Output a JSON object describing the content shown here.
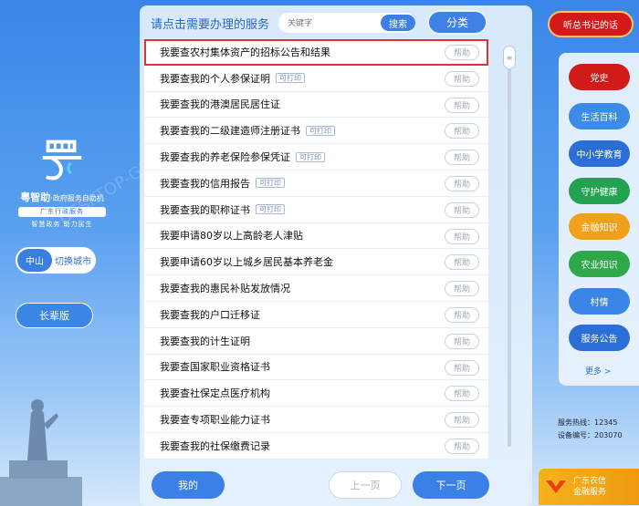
{
  "header": {
    "prompt": "请点击需要办理的服务",
    "search_placeholder": "关键字",
    "search_label": "搜索",
    "category_label": "分类"
  },
  "brand": {
    "title": "粤智助",
    "subtitle": "·政府服务自助机",
    "org": "广东行政服务",
    "slogan": "智慧政务  助力民生"
  },
  "city": {
    "current": "中山",
    "switch_label": "切换城市"
  },
  "elder_mode_label": "长辈版",
  "services": [
    {
      "label": "我要查农村集体资产的招标公告和结果",
      "printable": false,
      "selected": true
    },
    {
      "label": "我要查我的个人参保证明",
      "printable": true
    },
    {
      "label": "我要查我的港澳居民居住证",
      "printable": false
    },
    {
      "label": "我要查我的二级建造师注册证书",
      "printable": true
    },
    {
      "label": "我要查我的养老保险参保凭证",
      "printable": true
    },
    {
      "label": "我要查我的信用报告",
      "printable": true
    },
    {
      "label": "我要查我的职称证书",
      "printable": true
    },
    {
      "label": "我要申请80岁以上高龄老人津贴",
      "printable": false
    },
    {
      "label": "我要申请60岁以上城乡居民基本养老金",
      "printable": false
    },
    {
      "label": "我要查我的惠民补贴发放情况",
      "printable": false
    },
    {
      "label": "我要查我的户口迁移证",
      "printable": false
    },
    {
      "label": "我要查我的计生证明",
      "printable": false
    },
    {
      "label": "我要查国家职业资格证书",
      "printable": false
    },
    {
      "label": "我要查社保定点医疗机构",
      "printable": false
    },
    {
      "label": "我要查专项职业能力证书",
      "printable": false
    },
    {
      "label": "我要查我的社保缴费记录",
      "printable": false
    }
  ],
  "printable_tag": "可打印",
  "help_label": "帮助",
  "footer": {
    "mine": "我的",
    "prev": "上一页",
    "next": "下一页"
  },
  "right": {
    "listen_label": "听总书记的话",
    "buttons": [
      {
        "label": "党史",
        "color": "#d11b1b"
      },
      {
        "label": "生活百科",
        "color": "#3b8ce8"
      },
      {
        "label": "中小学教育",
        "color": "#2b6fd6"
      },
      {
        "label": "守护健康",
        "color": "#23a352"
      },
      {
        "label": "金融知识",
        "color": "#f0a11c"
      },
      {
        "label": "农业知识",
        "color": "#2fa84a"
      },
      {
        "label": "村情",
        "color": "#3a86e6"
      },
      {
        "label": "服务公告",
        "color": "#2b6fd6"
      }
    ],
    "more_label": "更多 >",
    "hotline": "服务热线：12345",
    "device_no": "设备编号：203070"
  },
  "badge": {
    "line1": "广东农信",
    "line2": "金融服务"
  },
  "watermark": "DESKTOP-GJH1V92  lenovo  2023-10-16",
  "colors": {
    "accent": "#3b80e6",
    "selection_outline": "#e53030",
    "party_red": "#d21a1a"
  }
}
